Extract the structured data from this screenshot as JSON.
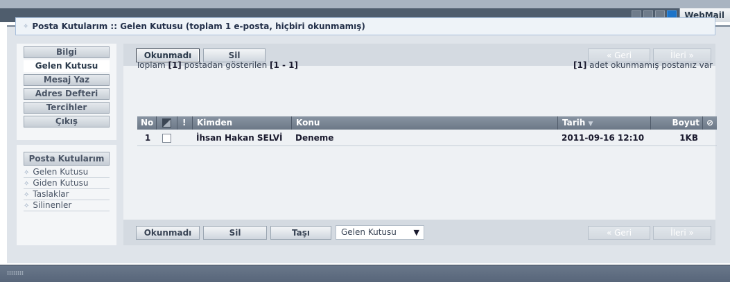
{
  "header": {
    "brand": "WebMail",
    "colors": {
      "accent": "#1d74c9",
      "bar_dark": "#4f5d6d",
      "panel": "#dfe4ea"
    }
  },
  "title": {
    "text": "Posta Kutularım :: Gelen Kutusu (toplam 1 e-posta, hiçbiri okunmamış)"
  },
  "nav": {
    "items": [
      {
        "label": "Bilgi",
        "active": false
      },
      {
        "label": "Gelen Kutusu",
        "active": true
      },
      {
        "label": "Mesaj Yaz",
        "active": false
      },
      {
        "label": "Adres Defteri",
        "active": false
      },
      {
        "label": "Tercihler",
        "active": false
      },
      {
        "label": "Çıkış",
        "active": false
      }
    ]
  },
  "folders": {
    "heading": "Posta Kutularım",
    "items": [
      "Gelen Kutusu",
      "Giden Kutusu",
      "Taslaklar",
      "Silinenler"
    ]
  },
  "toolbar": {
    "unread_label": "Okunmadı",
    "delete_label": "Sil",
    "move_label": "Taşı",
    "back_label": "« Geri",
    "next_label": "İleri »",
    "folder_select": "Gelen Kutusu"
  },
  "summary": {
    "prefix": "Toplam",
    "total": "[1]",
    "middle": "postadan gösterilen",
    "range": "[1 - 1]",
    "unread_count": "[1]",
    "unread_suffix": "adet okunmamış postanız var"
  },
  "table": {
    "headers": {
      "no": "No",
      "flag": "!",
      "from": "Kimden",
      "subject": "Konu",
      "date": "Tarih",
      "size": "Boyut"
    },
    "rows": [
      {
        "no": "1",
        "from": "İhsan Hakan SELVİ",
        "subject": "Deneme",
        "date": "2011-09-16 12:10",
        "size": "1KB"
      }
    ]
  }
}
